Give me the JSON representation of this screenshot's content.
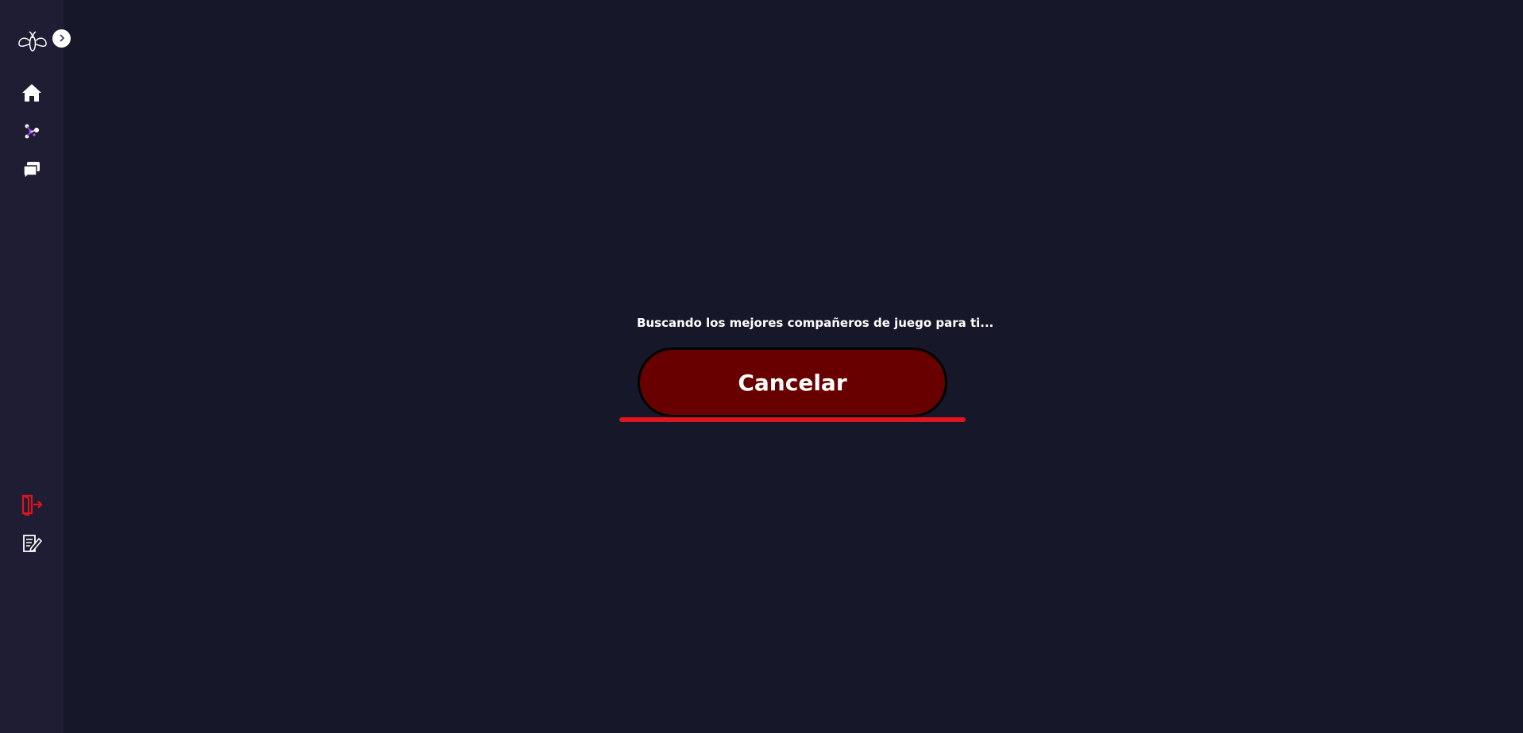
{
  "sidebar": {
    "logo_icon": "bee-logo-icon",
    "expand_icon": "chevron-right-icon",
    "nav_items": [
      {
        "icon": "home-icon"
      },
      {
        "icon": "matchmaking-icon"
      },
      {
        "icon": "chat-icon"
      }
    ],
    "bottom_items": [
      {
        "icon": "logout-icon",
        "color": "#e0141e"
      },
      {
        "icon": "edit-profile-icon"
      }
    ]
  },
  "main": {
    "status_text": "Buscando los mejores compañeros de juego para ti...",
    "cancel_label": "Cancelar"
  },
  "colors": {
    "background": "#17172a",
    "sidebar": "#1e1d33",
    "button": "#680000",
    "accent_red": "#e0141e"
  }
}
